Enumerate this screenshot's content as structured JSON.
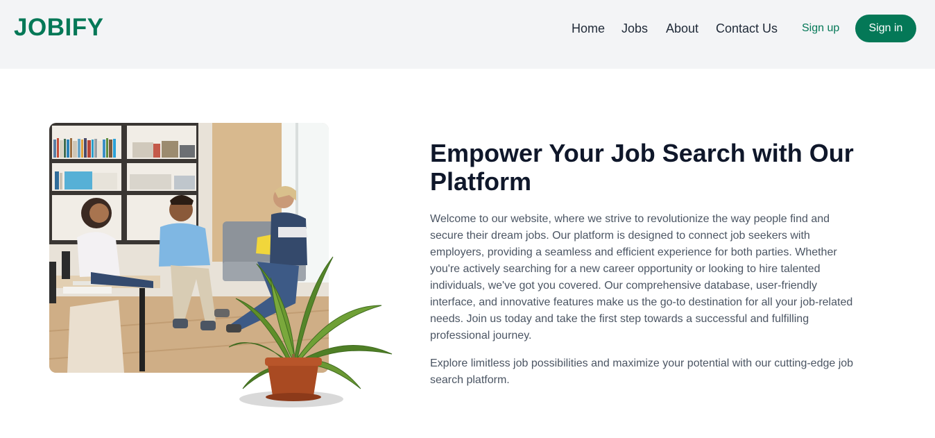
{
  "header": {
    "logo": "JOBIFY",
    "nav": [
      {
        "label": "Home"
      },
      {
        "label": "Jobs"
      },
      {
        "label": "About"
      },
      {
        "label": "Contact Us"
      }
    ],
    "signup_label": "Sign up",
    "signin_label": "Sign in"
  },
  "hero": {
    "image_alt": "Group of people talking in an office lounge with a potted plant",
    "title": "Empower Your Job Search with Our Platform",
    "paragraph1": "Welcome to our website, where we strive to revolutionize the way people find and secure their dream jobs. Our platform is designed to connect job seekers with employers, providing a seamless and efficient experience for both parties. Whether you're actively searching for a new career opportunity or looking to hire talented individuals, we've got you covered. Our comprehensive database, user-friendly interface, and innovative features make us the go-to destination for all your job-related needs. Join us today and take the first step towards a successful and fulfilling professional journey.",
    "paragraph2": "Explore limitless job possibilities and maximize your potential with our cutting-edge job search platform."
  },
  "colors": {
    "brand": "#047857",
    "header_bg": "#f3f4f6",
    "title": "#0f172a",
    "body_text": "#4b5563"
  }
}
